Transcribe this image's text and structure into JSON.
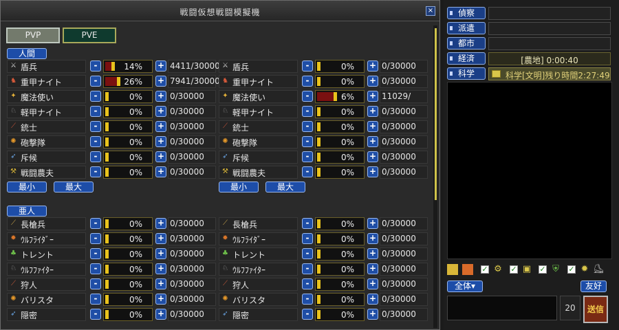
{
  "window": {
    "title": "戦闘仮想戦闘模擬機",
    "close_label": "×"
  },
  "modes": [
    {
      "label": "PVP",
      "active": true
    },
    {
      "label": "PVE",
      "active": false
    }
  ],
  "buttons": {
    "minus": "-",
    "plus": "+",
    "min_label": "最小",
    "max_label": "最大"
  },
  "sections": [
    {
      "label": "人間",
      "rows": [
        {
          "icon": "spear-icon",
          "glyph": "⚔",
          "name": "盾兵",
          "left": {
            "pct_text": "14%",
            "level": 0.14,
            "count": "4411/30000"
          },
          "right": {
            "pct_text": "0%",
            "level": 0,
            "count": "0/30000"
          }
        },
        {
          "icon": "heavy-knight-icon",
          "glyph": "♞",
          "name": "重甲ナイト",
          "left": {
            "pct_text": "26%",
            "level": 0.26,
            "count": "7941/30000"
          },
          "right": {
            "pct_text": "0%",
            "level": 0,
            "count": "0/30000"
          }
        },
        {
          "icon": "mage-icon",
          "glyph": "✦",
          "name": "魔法使い",
          "left": {
            "pct_text": "0%",
            "level": 0,
            "count": "0/30000"
          },
          "right": {
            "pct_text": "6%",
            "level": 0.36,
            "count": "11029/"
          }
        },
        {
          "icon": "light-knight-icon",
          "glyph": "♘",
          "name": "軽甲ナイト",
          "left": {
            "pct_text": "0%",
            "level": 0,
            "count": "0/30000"
          },
          "right": {
            "pct_text": "0%",
            "level": 0,
            "count": "0/30000"
          }
        },
        {
          "icon": "gun-icon",
          "glyph": "⟋",
          "name": "銃士",
          "left": {
            "pct_text": "0%",
            "level": 0,
            "count": "0/30000"
          },
          "right": {
            "pct_text": "0%",
            "level": 0,
            "count": "0/30000"
          }
        },
        {
          "icon": "cannon-icon",
          "glyph": "✺",
          "name": "砲撃隊",
          "left": {
            "pct_text": "0%",
            "level": 0,
            "count": "0/30000"
          },
          "right": {
            "pct_text": "0%",
            "level": 0,
            "count": "0/30000"
          }
        },
        {
          "icon": "scout-icon",
          "glyph": "➶",
          "name": "斥候",
          "left": {
            "pct_text": "0%",
            "level": 0,
            "count": "0/30000"
          },
          "right": {
            "pct_text": "0%",
            "level": 0,
            "count": "0/30000"
          }
        },
        {
          "icon": "farmer-icon",
          "glyph": "⚒",
          "name": "戦闘農夫",
          "left": {
            "pct_text": "0%",
            "level": 0,
            "count": "0/30000"
          },
          "right": {
            "pct_text": "0%",
            "level": 0,
            "count": "0/30000"
          }
        }
      ]
    },
    {
      "label": "亜人",
      "rows": [
        {
          "icon": "lance-icon",
          "glyph": "⟋",
          "name": "長槍兵",
          "left": {
            "pct_text": "0%",
            "level": 0,
            "count": "0/30000"
          },
          "right": {
            "pct_text": "0%",
            "level": 0,
            "count": "0/30000"
          }
        },
        {
          "icon": "wolf-rider-icon",
          "glyph": "✹",
          "name": "ｳﾙﾌﾗｲﾀﾞｰ",
          "left": {
            "pct_text": "0%",
            "level": 0,
            "count": "0/30000"
          },
          "right": {
            "pct_text": "0%",
            "level": 0,
            "count": "0/30000"
          }
        },
        {
          "icon": "treant-icon",
          "glyph": "♣",
          "name": "トレント",
          "left": {
            "pct_text": "0%",
            "level": 0,
            "count": "0/30000"
          },
          "right": {
            "pct_text": "0%",
            "level": 0,
            "count": "0/30000"
          }
        },
        {
          "icon": "wolf-fighter-icon",
          "glyph": "♘",
          "name": "ｳﾙﾌﾌｧｲﾀｰ",
          "left": {
            "pct_text": "0%",
            "level": 0,
            "count": "0/30000"
          },
          "right": {
            "pct_text": "0%",
            "level": 0,
            "count": "0/30000"
          }
        },
        {
          "icon": "hunter-icon",
          "glyph": "⟋",
          "name": "狩人",
          "left": {
            "pct_text": "0%",
            "level": 0,
            "count": "0/30000"
          },
          "right": {
            "pct_text": "0%",
            "level": 0,
            "count": "0/30000"
          }
        },
        {
          "icon": "ballista-icon",
          "glyph": "✺",
          "name": "バリスタ",
          "left": {
            "pct_text": "0%",
            "level": 0,
            "count": "0/30000"
          },
          "right": {
            "pct_text": "0%",
            "level": 0,
            "count": "0/30000"
          }
        },
        {
          "icon": "stealth-icon",
          "glyph": "➶",
          "name": "隠密",
          "left": {
            "pct_text": "0%",
            "level": 0,
            "count": "0/30000"
          },
          "right": {
            "pct_text": "0%",
            "level": 0,
            "count": "0/30000"
          }
        }
      ]
    }
  ],
  "side": {
    "tabs": [
      {
        "label": "偵察",
        "field": ""
      },
      {
        "label": "派遣",
        "field": ""
      },
      {
        "label": "都市",
        "field": ""
      },
      {
        "label": "経済",
        "field": "[農地] 0:00:40"
      },
      {
        "label": "科学",
        "field": "科学[文明]残り時間2:27:49"
      }
    ],
    "filter_icons": [
      "ally-person-icon",
      "enemy-person-icon",
      "gear-icon",
      "box-icon",
      "shield-icon",
      "sun-icon",
      "boot-icon"
    ],
    "scope_label": "全体▾",
    "fav_label": "友好",
    "char_count": "20",
    "send_label": "送信"
  },
  "colors": {
    "bar_fill": "#7a1010",
    "marker": "#e8c21c",
    "accent_blue": "#1d4da8"
  }
}
